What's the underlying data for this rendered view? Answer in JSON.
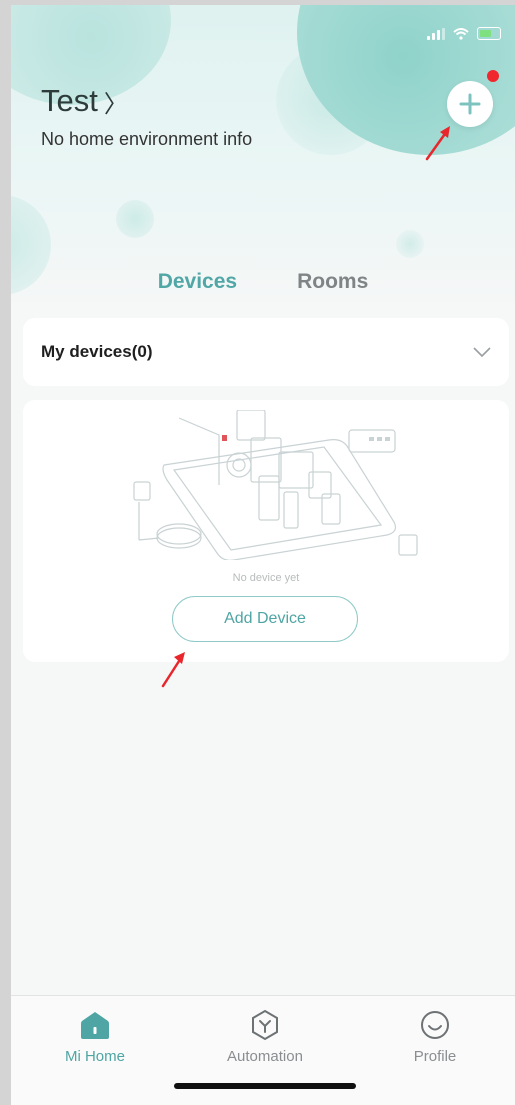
{
  "header": {
    "home_name": "Test",
    "home_chevron": "〉",
    "environment_info": "No home environment info",
    "add_icon": "plus-icon",
    "notification_dot_color": "#f0282d"
  },
  "tabs": [
    {
      "label": "Devices",
      "active": true
    },
    {
      "label": "Rooms",
      "active": false
    }
  ],
  "my_devices": {
    "label": "My devices(0)",
    "expand_icon": "chevron-down-icon"
  },
  "empty_state": {
    "message": "No device yet",
    "add_button_label": "Add Device"
  },
  "bottom_nav": [
    {
      "label": "Mi Home",
      "icon": "home-icon",
      "active": true
    },
    {
      "label": "Automation",
      "icon": "automation-icon",
      "active": false
    },
    {
      "label": "Profile",
      "icon": "profile-icon",
      "active": false
    }
  ],
  "colors": {
    "accent": "#51a7a6",
    "annotation_arrow": "#e8262b"
  }
}
